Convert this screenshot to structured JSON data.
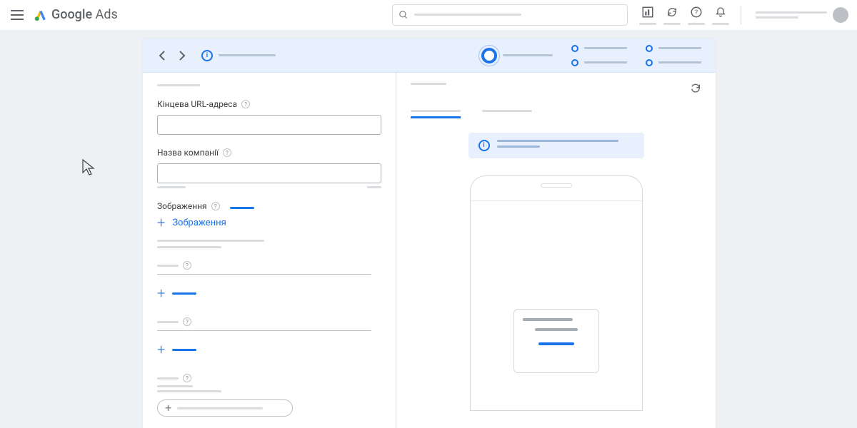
{
  "header": {
    "product_g": "Google",
    "product_ads": " Ads"
  },
  "form": {
    "url_label": "Кінцева URL-адреса",
    "company_label": "Назва компанії",
    "images_label": "Зображення",
    "add_images_label": "Зображення"
  }
}
